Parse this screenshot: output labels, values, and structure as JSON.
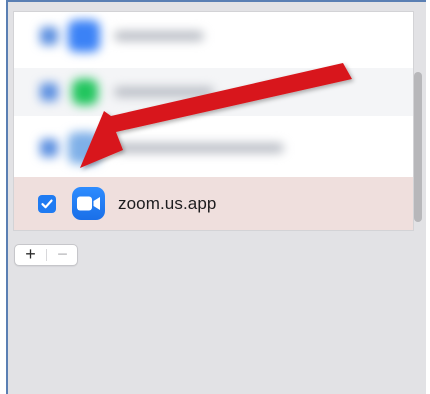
{
  "app_list": {
    "selected_item": {
      "label": "zoom.us.app",
      "checked": true,
      "icon": "zoom-video-camera-icon"
    },
    "blurred_items": [
      {
        "icon": "blurred-app-icon",
        "icon_color": "#3b82f6",
        "checked": true
      },
      {
        "icon": "blurred-app-icon",
        "icon_color": "#22c55e",
        "checked": true
      },
      {
        "icon": "blurred-app-icon",
        "icon_color": "#7fb0e8",
        "checked": true
      }
    ]
  },
  "controls": {
    "add_label": "+",
    "remove_label": "−"
  },
  "annotation": {
    "type": "arrow",
    "color": "#d8191c",
    "points_to": "zoom-checkbox"
  },
  "colors": {
    "accent": "#1f7bf2",
    "selected_row_bg": "#efdfdd",
    "panel_bg": "#e2e2e5"
  }
}
